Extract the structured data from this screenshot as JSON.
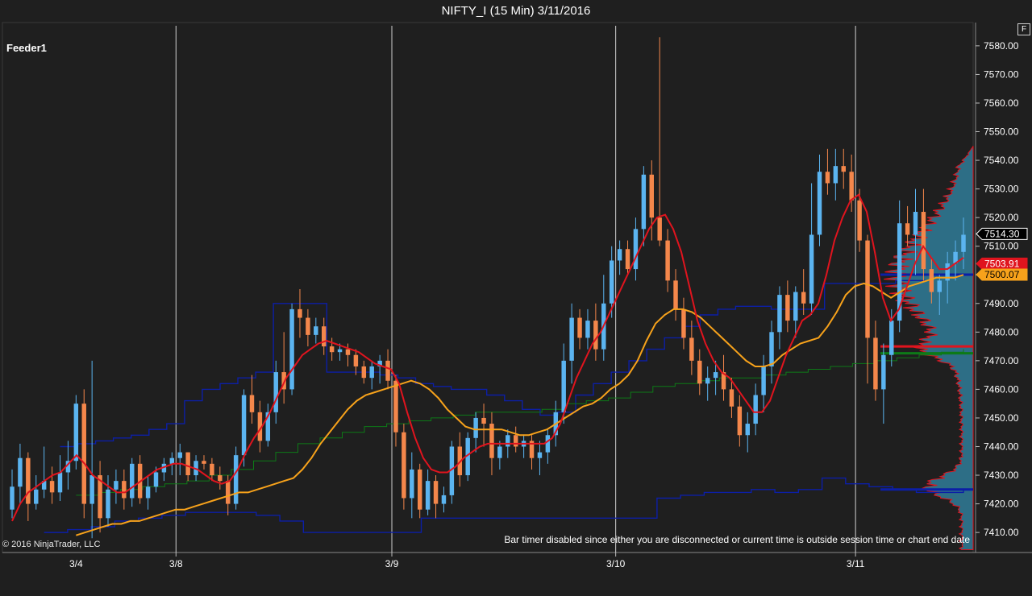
{
  "window": {
    "title": "NIFTY_I (15 Min)  3/11/2016",
    "f_button": "F"
  },
  "panel_label": "Feeder1",
  "copyright": "© 2016 NinjaTrader, LLC",
  "bar_timer_message": "Bar timer disabled since either you are disconnected or current time is outside session time or chart end date",
  "colors": {
    "background": "#1f1f1f",
    "up_candle": "#5bb4f0",
    "down_candle": "#f4874b",
    "fast_ma": "#e0141e",
    "slow_ma": "#f7a21b",
    "vwap": "#0d7a17",
    "channel": "#0c1fa6",
    "profile_fill": "#2d6e86",
    "profile_edge": "#e0141e",
    "session_line": "#d0d0d0"
  },
  "chart_data": {
    "type": "candlestick",
    "ylim": [
      7403,
      7587
    ],
    "y_ticks": [
      "7410.00",
      "7420.00",
      "7430.00",
      "7440.00",
      "7450.00",
      "7460.00",
      "7470.00",
      "7480.00",
      "7490.00",
      "7500.00",
      "7510.00",
      "7520.00",
      "7530.00",
      "7540.00",
      "7550.00",
      "7560.00",
      "7570.00",
      "7580.00"
    ],
    "x_labels": [
      "3/4",
      "3/8",
      "3/9",
      "3/10",
      "3/11"
    ],
    "price_labels": [
      {
        "text": "7514.30",
        "value": 7514.3,
        "style": "last"
      },
      {
        "text": "7503.91",
        "value": 7503.91,
        "style": "fast"
      },
      {
        "text": "7500.07",
        "value": 7500.07,
        "style": "slow"
      }
    ],
    "candles": [
      [
        7418,
        7432,
        7415,
        7426
      ],
      [
        7426,
        7441,
        7420,
        7436
      ],
      [
        7436,
        7438,
        7414,
        7420
      ],
      [
        7420,
        7430,
        7418,
        7425
      ],
      [
        7425,
        7440,
        7422,
        7428
      ],
      [
        7428,
        7433,
        7420,
        7424
      ],
      [
        7424,
        7437,
        7421,
        7431
      ],
      [
        7431,
        7442,
        7425,
        7435
      ],
      [
        7435,
        7458,
        7432,
        7455
      ],
      [
        7455,
        7460,
        7415,
        7420
      ],
      [
        7420,
        7470,
        7408,
        7430
      ],
      [
        7430,
        7435,
        7410,
        7415
      ],
      [
        7415,
        7430,
        7412,
        7425
      ],
      [
        7425,
        7432,
        7420,
        7428
      ],
      [
        7428,
        7432,
        7418,
        7422
      ],
      [
        7422,
        7436,
        7419,
        7434
      ],
      [
        7434,
        7437,
        7420,
        7422
      ],
      [
        7422,
        7430,
        7418,
        7426
      ],
      [
        7426,
        7433,
        7424,
        7431
      ],
      [
        7431,
        7436,
        7428,
        7434
      ],
      [
        7434,
        7438,
        7430,
        7436
      ],
      [
        7436,
        7441,
        7430,
        7438
      ],
      [
        7438,
        7438,
        7428,
        7430
      ],
      [
        7430,
        7437,
        7428,
        7435
      ],
      [
        7435,
        7437,
        7432,
        7434
      ],
      [
        7434,
        7436,
        7428,
        7430
      ],
      [
        7430,
        7433,
        7425,
        7428
      ],
      [
        7428,
        7430,
        7416,
        7420
      ],
      [
        7420,
        7440,
        7418,
        7437
      ],
      [
        7437,
        7460,
        7433,
        7458
      ],
      [
        7458,
        7465,
        7448,
        7452
      ],
      [
        7452,
        7456,
        7438,
        7442
      ],
      [
        7442,
        7455,
        7440,
        7452
      ],
      [
        7452,
        7470,
        7448,
        7466
      ],
      [
        7466,
        7480,
        7455,
        7460
      ],
      [
        7460,
        7490,
        7458,
        7488
      ],
      [
        7488,
        7495,
        7478,
        7485
      ],
      [
        7485,
        7488,
        7475,
        7479
      ],
      [
        7479,
        7485,
        7476,
        7482
      ],
      [
        7482,
        7485,
        7472,
        7475
      ],
      [
        7475,
        7478,
        7470,
        7473
      ],
      [
        7473,
        7476,
        7470,
        7474
      ],
      [
        7474,
        7476,
        7468,
        7472
      ],
      [
        7472,
        7474,
        7465,
        7468
      ],
      [
        7468,
        7470,
        7462,
        7464
      ],
      [
        7464,
        7470,
        7460,
        7468
      ],
      [
        7468,
        7472,
        7462,
        7470
      ],
      [
        7470,
        7474,
        7460,
        7463
      ],
      [
        7463,
        7465,
        7440,
        7445
      ],
      [
        7445,
        7448,
        7418,
        7422
      ],
      [
        7422,
        7438,
        7415,
        7432
      ],
      [
        7432,
        7434,
        7415,
        7418
      ],
      [
        7418,
        7432,
        7416,
        7428
      ],
      [
        7428,
        7430,
        7415,
        7420
      ],
      [
        7420,
        7426,
        7417,
        7423
      ],
      [
        7423,
        7442,
        7420,
        7440
      ],
      [
        7440,
        7445,
        7426,
        7430
      ],
      [
        7430,
        7445,
        7428,
        7443
      ],
      [
        7443,
        7452,
        7438,
        7450
      ],
      [
        7450,
        7455,
        7440,
        7448
      ],
      [
        7448,
        7452,
        7430,
        7436
      ],
      [
        7436,
        7442,
        7432,
        7440
      ],
      [
        7440,
        7446,
        7436,
        7444
      ],
      [
        7444,
        7447,
        7438,
        7440
      ],
      [
        7440,
        7444,
        7436,
        7442
      ],
      [
        7442,
        7444,
        7432,
        7436
      ],
      [
        7436,
        7442,
        7430,
        7438
      ],
      [
        7438,
        7446,
        7434,
        7444
      ],
      [
        7444,
        7456,
        7440,
        7452
      ],
      [
        7452,
        7476,
        7448,
        7470
      ],
      [
        7470,
        7490,
        7462,
        7485
      ],
      [
        7485,
        7488,
        7474,
        7478
      ],
      [
        7478,
        7488,
        7474,
        7484
      ],
      [
        7484,
        7490,
        7470,
        7474
      ],
      [
        7474,
        7500,
        7470,
        7490
      ],
      [
        7490,
        7510,
        7485,
        7505
      ],
      [
        7505,
        7512,
        7500,
        7509
      ],
      [
        7509,
        7512,
        7500,
        7502
      ],
      [
        7502,
        7520,
        7498,
        7516
      ],
      [
        7516,
        7538,
        7510,
        7535
      ],
      [
        7535,
        7540,
        7512,
        7520
      ],
      [
        7520,
        7583,
        7510,
        7512
      ],
      [
        7512,
        7516,
        7494,
        7498
      ],
      [
        7498,
        7502,
        7484,
        7488
      ],
      [
        7488,
        7492,
        7474,
        7478
      ],
      [
        7478,
        7484,
        7465,
        7470
      ],
      [
        7470,
        7474,
        7458,
        7462
      ],
      [
        7462,
        7468,
        7456,
        7464
      ],
      [
        7464,
        7470,
        7458,
        7466
      ],
      [
        7466,
        7472,
        7456,
        7460
      ],
      [
        7460,
        7464,
        7450,
        7454
      ],
      [
        7454,
        7458,
        7440,
        7444
      ],
      [
        7444,
        7452,
        7438,
        7448
      ],
      [
        7448,
        7462,
        7444,
        7458
      ],
      [
        7458,
        7472,
        7452,
        7468
      ],
      [
        7468,
        7484,
        7462,
        7480
      ],
      [
        7480,
        7496,
        7474,
        7493
      ],
      [
        7493,
        7498,
        7480,
        7484
      ],
      [
        7484,
        7496,
        7478,
        7494
      ],
      [
        7494,
        7502,
        7486,
        7490
      ],
      [
        7490,
        7532,
        7486,
        7514
      ],
      [
        7514,
        7542,
        7510,
        7536
      ],
      [
        7536,
        7544,
        7528,
        7532
      ],
      [
        7532,
        7544,
        7526,
        7538
      ],
      [
        7538,
        7544,
        7530,
        7536
      ],
      [
        7536,
        7542,
        7522,
        7526
      ],
      [
        7526,
        7530,
        7508,
        7512
      ],
      [
        7512,
        7514,
        7462,
        7478
      ],
      [
        7478,
        7484,
        7456,
        7460
      ],
      [
        7460,
        7476,
        7448,
        7472
      ],
      [
        7472,
        7488,
        7468,
        7484
      ],
      [
        7484,
        7526,
        7480,
        7518
      ],
      [
        7518,
        7524,
        7510,
        7514
      ],
      [
        7514,
        7530,
        7500,
        7522
      ],
      [
        7522,
        7530,
        7498,
        7502
      ],
      [
        7502,
        7506,
        7490,
        7494
      ],
      [
        7494,
        7500,
        7486,
        7498
      ],
      [
        7498,
        7508,
        7490,
        7504
      ],
      [
        7504,
        7512,
        7498,
        7508
      ],
      [
        7508,
        7520,
        7502,
        7514
      ]
    ],
    "session_starts": [
      21,
      48,
      76,
      106
    ],
    "fast_ma": [
      7414,
      7420,
      7424,
      7426,
      7428,
      7430,
      7431,
      7434,
      7437,
      7434,
      7430,
      7428,
      7426,
      7424,
      7424,
      7426,
      7428,
      7430,
      7432,
      7433,
      7434,
      7434,
      7433,
      7432,
      7430,
      7428,
      7427,
      7428,
      7432,
      7438,
      7443,
      7447,
      7452,
      7458,
      7464,
      7468,
      7472,
      7474,
      7476,
      7477,
      7476,
      7475,
      7474,
      7473,
      7471,
      7469,
      7468,
      7467,
      7462,
      7452,
      7443,
      7436,
      7432,
      7431,
      7431,
      7433,
      7436,
      7438,
      7440,
      7441,
      7441,
      7441,
      7441,
      7441,
      7441,
      7441,
      7441,
      7443,
      7448,
      7456,
      7464,
      7470,
      7476,
      7480,
      7486,
      7492,
      7498,
      7504,
      7510,
      7516,
      7520,
      7521,
      7516,
      7508,
      7496,
      7484,
      7476,
      7470,
      7466,
      7464,
      7460,
      7456,
      7452,
      7452,
      7456,
      7464,
      7472,
      7478,
      7484,
      7486,
      7490,
      7500,
      7512,
      7520,
      7526,
      7528,
      7522,
      7508,
      7492,
      7484,
      7488,
      7496,
      7504,
      7510,
      7506,
      7502,
      7502,
      7504,
      7506
    ],
    "slow_ma": [
      7409,
      7410,
      7411,
      7412,
      7413,
      7413,
      7414,
      7414,
      7415,
      7416,
      7417,
      7418,
      7418,
      7419,
      7420,
      7421,
      7422,
      7423,
      7424,
      7424,
      7425,
      7426,
      7427,
      7428,
      7429,
      7432,
      7436,
      7441,
      7445,
      7449,
      7453,
      7456,
      7458,
      7459,
      7460,
      7461,
      7462,
      7463,
      7462,
      7460,
      7457,
      7453,
      7450,
      7447,
      7446,
      7446,
      7446,
      7446,
      7445,
      7444,
      7444,
      7445,
      7446,
      7448,
      7450,
      7452,
      7454,
      7455,
      7457,
      7460,
      7462,
      7465,
      7470,
      7477,
      7483,
      7486,
      7488,
      7488,
      7487,
      7485,
      7482,
      7479,
      7476,
      7473,
      7470,
      7468,
      7468,
      7469,
      7472,
      7474,
      7476,
      7477,
      7478,
      7482,
      7487,
      7493,
      7496,
      7497,
      7496,
      7494,
      7492,
      7494,
      7496,
      7497,
      7498,
      7499,
      7499,
      7499,
      7500
    ],
    "vwap": [
      7423,
      7424,
      7425,
      7426,
      7427,
      7428,
      7430,
      7432,
      7435,
      7438,
      7441,
      7443,
      7445,
      7447,
      7448,
      7449,
      7450,
      7451,
      7452,
      7452,
      7452,
      7453,
      7455,
      7456,
      7457,
      7459,
      7461,
      7462,
      7463,
      7464,
      7464,
      7465,
      7466,
      7467,
      7468,
      7469,
      7470,
      7471,
      7472,
      7473,
      7474
    ],
    "channel_upper": [
      7440,
      7441,
      7442,
      7443,
      7444,
      7446,
      7448,
      7456,
      7460,
      7462,
      7464,
      7466,
      7490,
      7490,
      7490,
      7466,
      7466,
      7466,
      7465,
      7464,
      7462,
      7461,
      7460,
      7460,
      7458,
      7456,
      7453,
      7451,
      7452,
      7458,
      7462,
      7466,
      7470,
      7474,
      7478,
      7482,
      7486,
      7488,
      7489,
      7489,
      7488,
      7488,
      7488,
      7497,
      7497,
      7497,
      7497,
      7498,
      7498,
      7500
    ],
    "channel_lower": [
      7410,
      7411,
      7412,
      7414,
      7415,
      7416,
      7417,
      7417,
      7417,
      7416,
      7414,
      7410,
      7410,
      7410,
      7410,
      7410,
      7415,
      7415,
      7415,
      7415,
      7415,
      7415,
      7415,
      7415,
      7415,
      7415,
      7422,
      7423,
      7424,
      7424,
      7425,
      7424,
      7425,
      7429,
      7427,
      7426,
      7425,
      7424,
      7424,
      7425
    ],
    "profile_max_width": 115,
    "profile_lines": [
      {
        "value": 7500.07,
        "color": "#0c1fa6"
      },
      {
        "value": 7472.6,
        "color": "#0d7a17"
      },
      {
        "value": 7475,
        "color": "#e0141e"
      },
      {
        "value": 7425,
        "color": "#0c1fa6"
      }
    ]
  }
}
